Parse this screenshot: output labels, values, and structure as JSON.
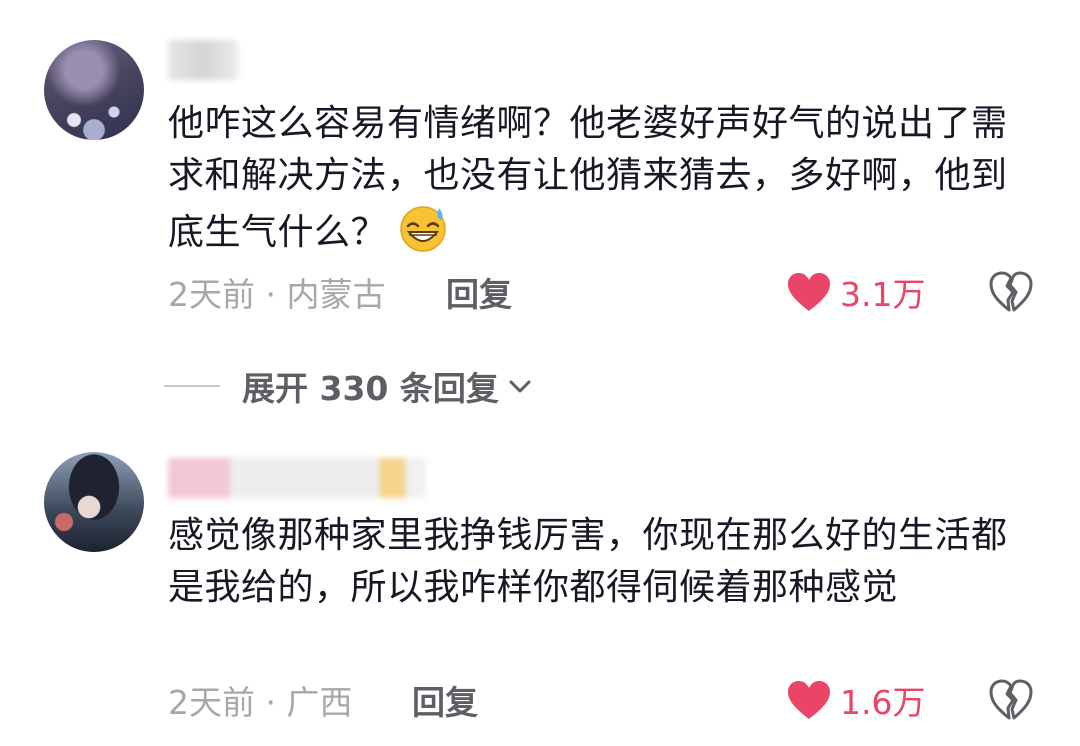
{
  "comments": [
    {
      "text": "他咋这么容易有情绪啊？他老婆好声好气的说出了需求和解决方法，也没有让他猜来猜去，多好啊，他到底生气什么？",
      "emoji": "grinning-sweat-emoji",
      "meta": "2天前 · 内蒙古",
      "reply_label": "回复",
      "likes": "3.1万"
    },
    {
      "text": "感觉像那种家里我挣钱厉害，你现在那么好的生活都是我给的，所以我咋样你都得伺候着那种感觉",
      "meta": "2天前 · 广西",
      "reply_label": "回复",
      "likes": "1.6万"
    }
  ],
  "expand_replies": {
    "label": "展开 330 条回复"
  },
  "colors": {
    "like_red": "#ea4466",
    "meta_gray": "#a8a8ab",
    "text": "#161823"
  },
  "icons": [
    "heart-icon",
    "broken-heart-icon",
    "chevron-down-icon"
  ]
}
